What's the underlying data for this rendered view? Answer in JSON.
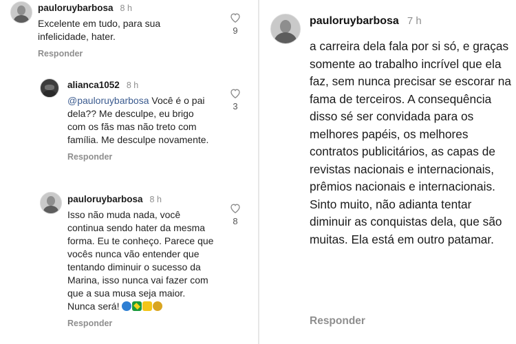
{
  "left_comments": [
    {
      "username": "pauloruybarbosa",
      "time": "8 h",
      "text": "Excelente em tudo, para sua infelicidade, hater.",
      "reply": "Responder",
      "likes": "9"
    },
    {
      "username": "alianca1052",
      "time": "8 h",
      "mention": "@pauloruybarbosa",
      "text": " Você é o pai dela?? Me desculpe, eu brigo com os fãs mas não treto com família. Me desculpe novamente.",
      "reply": "Responder",
      "likes": "3"
    },
    {
      "username": "pauloruybarbosa",
      "time": "8 h",
      "text": "Isso não muda nada, você continua sendo hater da mesma forma. Eu te conheço. Parece que vocês nunca vão entender que tentando diminuir o sucesso da Marina, isso nunca vai fazer com que a sua musa seja maior. Nunca será!",
      "emojis": [
        "globe-emoji",
        "brazil-flag-emoji",
        "crown-emoji",
        "medal-emoji"
      ],
      "reply": "Responder",
      "likes": "8"
    }
  ],
  "right_comment": {
    "username": "pauloruybarbosa",
    "time": "7 h",
    "text": "a carreira dela fala por si só, e graças somente ao trabalho incrível que ela faz, sem nunca precisar se escorar na fama de terceiros. A consequência disso sé ser convidada para os melhores papéis, os melhores contratos publicitários, as capas de revistas nacionais e internacionais, prêmios nacionais e internacionais. Sinto muito, não adianta tentar diminuir as conquistas dela, que são muitas. Ela está em outro patamar.",
    "reply": "Responder"
  },
  "colors": {
    "username": "#1a1a1a",
    "muted": "#8e8e8e",
    "mention": "#3b5b8f"
  }
}
